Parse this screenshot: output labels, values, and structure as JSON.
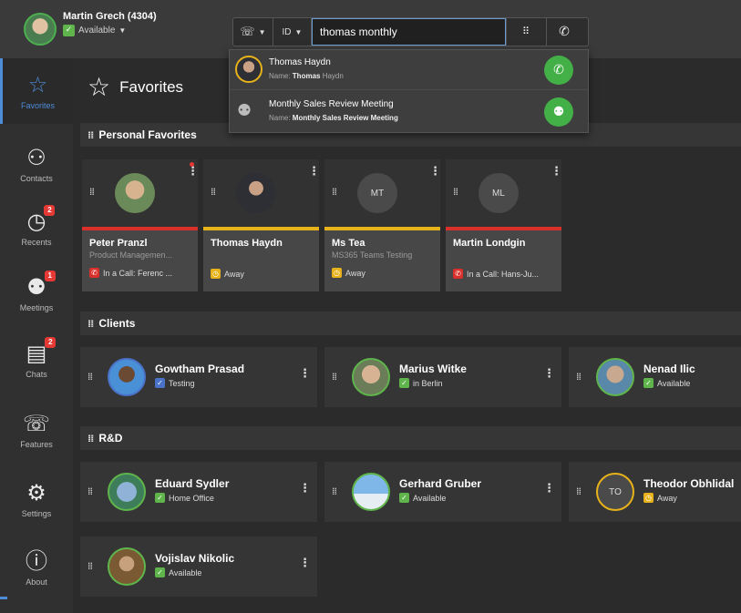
{
  "user": {
    "name": "Martin Grech (4304)",
    "status": "Available"
  },
  "search": {
    "value": "thomas monthly",
    "type_label": "ID"
  },
  "dropdown": [
    {
      "title": "Thomas Haydn",
      "sub_prefix": "Name: ",
      "sub_bold": "Thomas",
      "sub_rest": " Haydn"
    },
    {
      "title": "Monthly Sales Review Meeting",
      "sub_prefix": "Name: ",
      "sub_bold": "Monthly Sales Review Meeting",
      "sub_rest": ""
    }
  ],
  "sidebar": [
    {
      "label": "Favorites",
      "icon": "star-icon",
      "badge": ""
    },
    {
      "label": "Contacts",
      "icon": "person-icon",
      "badge": ""
    },
    {
      "label": "Recents",
      "icon": "clock-icon",
      "badge": "2"
    },
    {
      "label": "Meetings",
      "icon": "group-icon",
      "badge": "1"
    },
    {
      "label": "Chats",
      "icon": "chat-icon",
      "badge": "2"
    },
    {
      "label": "Features",
      "icon": "phone-features-icon",
      "badge": ""
    },
    {
      "label": "Settings",
      "icon": "gear-icon",
      "badge": ""
    },
    {
      "label": "About",
      "icon": "info-icon",
      "badge": ""
    }
  ],
  "page_title": "Favorites",
  "sections": {
    "personal": "Personal Favorites",
    "clients": "Clients",
    "rnd": "R&D"
  },
  "favorites": [
    {
      "name": "Peter Pranzl",
      "sub": "Product Managemen...",
      "status": "In a Call: Ferenc ...",
      "initials": "",
      "stripe": "#d9302b",
      "status_color": "#d9302b"
    },
    {
      "name": "Thomas Haydn",
      "sub": "",
      "status": "Away",
      "initials": "",
      "stripe": "#e8b21a",
      "status_color": "#e8b21a"
    },
    {
      "name": "Ms Tea",
      "sub": "MS365 Teams Testing",
      "status": "Away",
      "initials": "MT",
      "stripe": "#e8b21a",
      "status_color": "#e8b21a"
    },
    {
      "name": "Martin Londgin",
      "sub": "",
      "status": "In a Call: Hans-Ju...",
      "initials": "ML",
      "stripe": "#d9302b",
      "status_color": "#d9302b"
    }
  ],
  "clients": [
    {
      "name": "Gowtham Prasad",
      "status": "Testing",
      "status_color": "#4a72c9"
    },
    {
      "name": "Marius Witke",
      "status": "in Berlin",
      "status_color": "#5fb54b"
    },
    {
      "name": "Nenad Ilic",
      "status": "Available",
      "status_color": "#5fb54b"
    }
  ],
  "rnd": [
    {
      "name": "Eduard Sydler",
      "status": "Home Office",
      "status_color": "#5fb54b",
      "initials": ""
    },
    {
      "name": "Gerhard Gruber",
      "status": "Available",
      "status_color": "#5fb54b",
      "initials": ""
    },
    {
      "name": "Theodor Obhlidal",
      "status": "Away",
      "status_color": "#e8b21a",
      "initials": "TO"
    },
    {
      "name": "Vojislav Nikolic",
      "status": "Available",
      "status_color": "#5fb54b",
      "initials": ""
    }
  ]
}
